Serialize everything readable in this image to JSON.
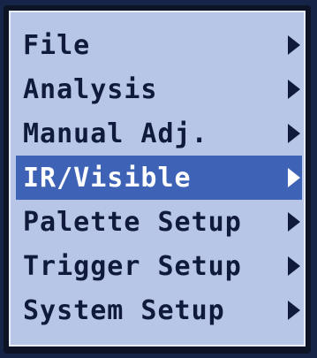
{
  "menu": {
    "items": [
      {
        "label": "File",
        "selected": false
      },
      {
        "label": "Analysis",
        "selected": false
      },
      {
        "label": "Manual Adj.",
        "selected": false
      },
      {
        "label": "IR/Visible",
        "selected": true
      },
      {
        "label": "Palette Setup",
        "selected": false
      },
      {
        "label": "Trigger Setup",
        "selected": false
      },
      {
        "label": "System Setup",
        "selected": false
      }
    ]
  },
  "colors": {
    "panel_background": "#b7c6e6",
    "highlight": "#3e62b6",
    "text": "#101a3a",
    "highlight_text": "#ffffff"
  }
}
